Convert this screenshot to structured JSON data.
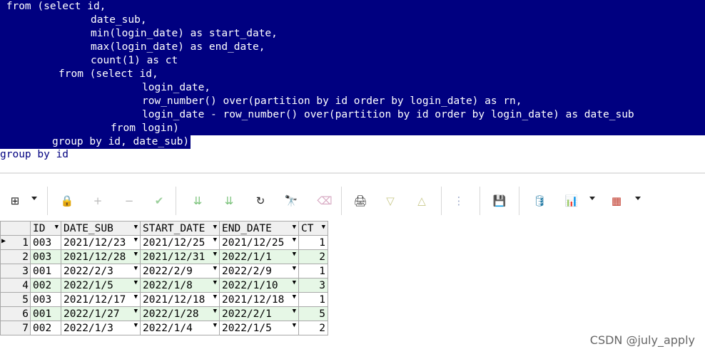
{
  "editor": {
    "lines": [
      {
        "text": " from (select id,",
        "selected": true,
        "indent": 0
      },
      {
        "text": "date_sub,",
        "selected": true,
        "indent": 127
      },
      {
        "text": "min(login_date) as start_date,",
        "selected": true,
        "indent": 127
      },
      {
        "text": "max(login_date) as end_date,",
        "selected": true,
        "indent": 127
      },
      {
        "text": "count(1) as ct",
        "selected": true,
        "indent": 127
      },
      {
        "text": "from (select id,",
        "selected": true,
        "indent": 82
      },
      {
        "text": "login_date,",
        "selected": true,
        "indent": 199
      },
      {
        "text": "row_number() over(partition by id order by login_date) as rn,",
        "selected": true,
        "indent": 199
      },
      {
        "text": "login_date - row_number() over(partition by id order by login_date) as date_sub",
        "selected": true,
        "indent": 199
      },
      {
        "text": "from login)",
        "selected": true,
        "indent": 155
      },
      {
        "text": "group by id, date_sub)",
        "selected": true,
        "indent": 73
      },
      {
        "text": "group by id",
        "selected": false,
        "indent": 0
      }
    ]
  },
  "toolbar": {
    "buttons": [
      {
        "name": "grid-view-icon",
        "glyph": "⊞"
      },
      {
        "name": "lock-icon",
        "glyph": "🔒"
      },
      {
        "name": "add-record-icon",
        "glyph": "+"
      },
      {
        "name": "delete-record-icon",
        "glyph": "−"
      },
      {
        "name": "post-icon",
        "glyph": "✔"
      },
      {
        "name": "refresh-down-icon",
        "glyph": "⇊"
      },
      {
        "name": "refresh-alt-icon",
        "glyph": "⇊"
      },
      {
        "name": "reload-icon",
        "glyph": "↻"
      },
      {
        "name": "find-icon",
        "glyph": "🔭"
      },
      {
        "name": "clear-filter-icon",
        "glyph": "⌫"
      },
      {
        "name": "print-preview-icon",
        "glyph": "🖨"
      },
      {
        "name": "sort-down-icon",
        "glyph": "▽"
      },
      {
        "name": "sort-up-icon",
        "glyph": "△"
      },
      {
        "name": "tree-icon",
        "glyph": "⋮"
      },
      {
        "name": "save-icon",
        "glyph": "💾"
      },
      {
        "name": "database-icon",
        "glyph": "🛢"
      },
      {
        "name": "chart-icon",
        "glyph": "📊"
      },
      {
        "name": "table-export-icon",
        "glyph": "▦"
      }
    ]
  },
  "grid": {
    "columns": [
      "ID",
      "DATE_SUB",
      "START_DATE",
      "END_DATE",
      "CT"
    ],
    "rows": [
      {
        "n": "1",
        "id": "003",
        "date_sub": "2021/12/23",
        "start": "2021/12/25",
        "end": "2021/12/25",
        "ct": "1"
      },
      {
        "n": "2",
        "id": "003",
        "date_sub": "2021/12/28",
        "start": "2021/12/31",
        "end": "2022/1/1",
        "ct": "2"
      },
      {
        "n": "3",
        "id": "001",
        "date_sub": "2022/2/3",
        "start": "2022/2/9",
        "end": "2022/2/9",
        "ct": "1"
      },
      {
        "n": "4",
        "id": "002",
        "date_sub": "2022/1/5",
        "start": "2022/1/8",
        "end": "2022/1/10",
        "ct": "3"
      },
      {
        "n": "5",
        "id": "003",
        "date_sub": "2021/12/17",
        "start": "2021/12/18",
        "end": "2021/12/18",
        "ct": "1"
      },
      {
        "n": "6",
        "id": "001",
        "date_sub": "2022/1/27",
        "start": "2022/1/28",
        "end": "2022/2/1",
        "ct": "5"
      },
      {
        "n": "7",
        "id": "002",
        "date_sub": "2022/1/3",
        "start": "2022/1/4",
        "end": "2022/1/5",
        "ct": "2"
      }
    ]
  },
  "watermark": "CSDN @july_apply",
  "colors": {
    "selection": "#000080",
    "alt_row": "#e6f7e6"
  }
}
